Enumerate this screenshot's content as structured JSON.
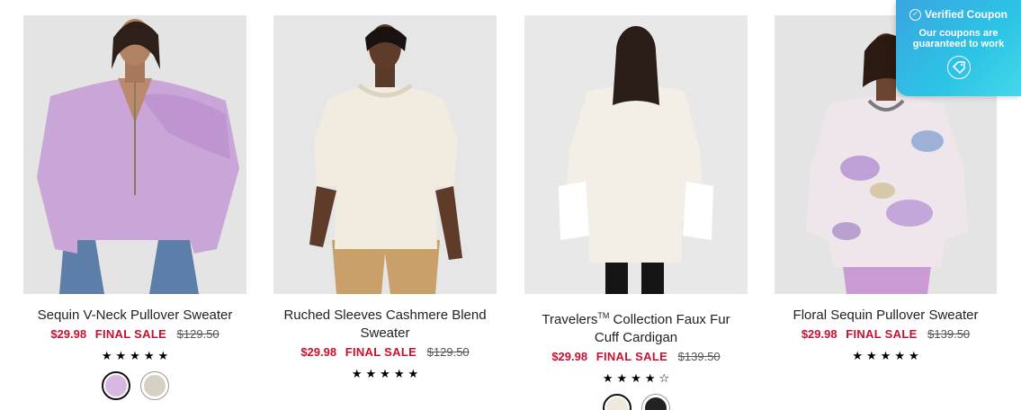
{
  "products": [
    {
      "name": "Sequin V-Neck Pullover Sweater",
      "tm": "",
      "name_rest": "",
      "price": "$29.98",
      "final_sale": "FINAL SALE",
      "original_price": "$129.50",
      "rating": 5,
      "swatches": [
        {
          "color": "#d6b8e3",
          "selected": true
        },
        {
          "color": "#d7d0c7",
          "selected": false
        }
      ]
    },
    {
      "name": "Ruched Sleeves Cashmere Blend Sweater",
      "tm": "",
      "name_rest": "",
      "price": "$29.98",
      "final_sale": "FINAL SALE",
      "original_price": "$129.50",
      "rating": 5,
      "swatches": []
    },
    {
      "name": "Travelers",
      "tm": "TM",
      "name_rest": " Collection Faux Fur Cuff Cardigan",
      "price": "$29.98",
      "final_sale": "FINAL SALE",
      "original_price": "$139.50",
      "rating": 4,
      "swatches": [
        {
          "color": "#ede9df",
          "selected": true
        },
        {
          "color": "#222222",
          "selected": false
        }
      ]
    },
    {
      "name": "Floral Sequin Pullover Sweater",
      "tm": "",
      "name_rest": "",
      "price": "$29.98",
      "final_sale": "FINAL SALE",
      "original_price": "$139.50",
      "rating": 5,
      "swatches": []
    }
  ],
  "coupon": {
    "title": "Verified Coupon",
    "subtitle": "Our coupons are guaranteed to work",
    "icon": "price-tag-icon",
    "colors": {
      "from": "#3aa5e0",
      "to": "#46d7ea"
    }
  },
  "colors": {
    "sale": "#c8102e",
    "photo_bg": "#e6e6e6"
  },
  "star_full": "★",
  "star_empty": "☆"
}
